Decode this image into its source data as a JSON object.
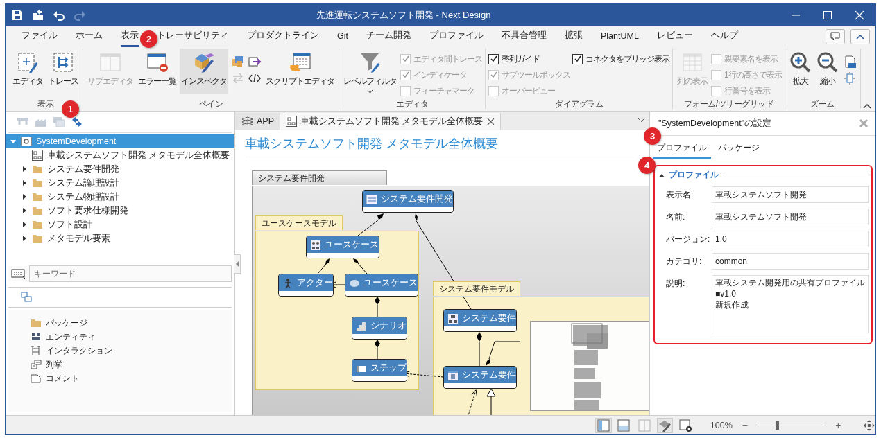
{
  "window": {
    "title": "先進運転システムソフト開発 - Next Design"
  },
  "menu_tabs": [
    {
      "label": "ファイル",
      "selected": false
    },
    {
      "label": "ホーム",
      "selected": false
    },
    {
      "label": "表示",
      "selected": true
    },
    {
      "label": "トレーサビリティ",
      "selected": false
    },
    {
      "label": "プロダクトライン",
      "selected": false
    },
    {
      "label": "Git",
      "selected": false
    },
    {
      "label": "チーム開発",
      "selected": false
    },
    {
      "label": "プロファイル",
      "selected": false
    },
    {
      "label": "不具合管理",
      "selected": false
    },
    {
      "label": "拡張",
      "selected": false
    },
    {
      "label": "PlantUML",
      "selected": false
    },
    {
      "label": "レビュー",
      "selected": false
    },
    {
      "label": "ヘルプ",
      "selected": false
    }
  ],
  "ribbon": [
    {
      "label": "表示",
      "columns": [
        [
          {
            "kind": "large",
            "label": "エディタ",
            "disabled": false,
            "selected": false
          }
        ],
        [
          {
            "kind": "large",
            "label": "トレース",
            "disabled": false,
            "selected": false
          }
        ]
      ]
    },
    {
      "label": "ペイン",
      "columns": [
        [
          {
            "kind": "large",
            "label": "サブエディタ",
            "disabled": true,
            "selected": false
          }
        ],
        [
          {
            "kind": "large",
            "label": "エラー一覧",
            "disabled": false,
            "selected": false
          }
        ],
        [
          {
            "kind": "large",
            "label": "インスペクタ",
            "disabled": false,
            "selected": true
          }
        ],
        [
          {
            "kind": "icon",
            "disabled": false
          },
          {
            "kind": "icon",
            "disabled": false
          },
          {
            "kind": "icon",
            "disabled": true
          },
          {
            "kind": "icon",
            "disabled": false
          }
        ],
        [
          {
            "kind": "large",
            "label": "スクリプトエディタ",
            "disabled": false,
            "selected": false
          }
        ]
      ]
    },
    {
      "label": "エディタ",
      "columns": [
        [
          {
            "kind": "large",
            "label": "レベルフィルタ",
            "disabled": false,
            "selected": false,
            "dropdown": true
          }
        ],
        [
          {
            "kind": "check",
            "label": "エディタ間トレース",
            "checked": true,
            "disabled": true
          },
          {
            "kind": "check",
            "label": "インディケータ",
            "checked": true,
            "disabled": true
          },
          {
            "kind": "check",
            "label": "フィーチャマーク",
            "checked": false,
            "disabled": true
          }
        ]
      ]
    },
    {
      "label": "ダイアグラム",
      "columns": [
        [
          {
            "kind": "check",
            "label": "整列ガイド",
            "checked": true,
            "disabled": false
          },
          {
            "kind": "check",
            "label": "サブツールボックス",
            "checked": true,
            "disabled": true
          },
          {
            "kind": "check",
            "label": "オーバービュー",
            "checked": false,
            "disabled": true
          }
        ],
        [
          {
            "kind": "check",
            "label": "コネクタをブリッジ表示",
            "checked": true,
            "disabled": false
          }
        ]
      ]
    },
    {
      "label": "フォーム/ツリーグリッド",
      "columns": [
        [
          {
            "kind": "large",
            "label": "列の表示",
            "disabled": true,
            "selected": false
          }
        ],
        [
          {
            "kind": "check",
            "label": "親要素名を表示",
            "checked": false,
            "disabled": true
          },
          {
            "kind": "check",
            "label": "1行の高さで表示",
            "checked": false,
            "disabled": true
          },
          {
            "kind": "check",
            "label": "行番号を表示",
            "checked": false,
            "disabled": true
          }
        ]
      ]
    },
    {
      "label": "ズーム",
      "columns": [
        [
          {
            "kind": "large",
            "label": "拡大",
            "disabled": false,
            "selected": false
          }
        ],
        [
          {
            "kind": "large",
            "label": "縮小",
            "disabled": false,
            "selected": false
          }
        ],
        [
          {
            "kind": "icon",
            "disabled": false
          },
          {
            "kind": "icon",
            "disabled": false
          }
        ]
      ]
    }
  ],
  "tree": [
    {
      "label": "SystemDevelopment",
      "kind": "model",
      "selected": true,
      "expanded": true,
      "children": [
        {
          "label": "車載システムソフト開発 メタモデル全体概要",
          "kind": "diagram",
          "selected": false
        },
        {
          "label": "システム要件開発",
          "kind": "folder",
          "selected": false,
          "expanded": false
        },
        {
          "label": "システム論理設計",
          "kind": "folder",
          "selected": false,
          "expanded": false
        },
        {
          "label": "システム物理設計",
          "kind": "folder",
          "selected": false,
          "expanded": false
        },
        {
          "label": "ソフト要求仕様開発",
          "kind": "folder",
          "selected": false,
          "expanded": false
        },
        {
          "label": "ソフト設計",
          "kind": "folder",
          "selected": false,
          "expanded": false
        },
        {
          "label": "メタモデル要素",
          "kind": "folder",
          "selected": false,
          "expanded": false
        }
      ]
    }
  ],
  "search": {
    "placeholder": "キーワード"
  },
  "palette": [
    {
      "label": "パッケージ"
    },
    {
      "label": "エンティティ"
    },
    {
      "label": "インタラクション"
    },
    {
      "label": "列挙"
    },
    {
      "label": "コメント"
    }
  ],
  "doc_tabs": [
    {
      "label": "APP",
      "selected": false,
      "closable": false
    },
    {
      "label": "車載システムソフト開発 メタモデル全体概要",
      "selected": true,
      "closable": true
    }
  ],
  "diagram": {
    "title": "車載システムソフト開発 メタモデル全体概要",
    "packages": [
      {
        "label": "システム要件開発"
      },
      {
        "label": "ユースケースモデル"
      },
      {
        "label": "システム要件モデル"
      }
    ],
    "nodes": [
      {
        "label": "システム要件開発"
      },
      {
        "label": "ユースケース"
      },
      {
        "label": "アクター"
      },
      {
        "label": "ユースケース"
      },
      {
        "label": "シナリオ"
      },
      {
        "label": "ステップ"
      },
      {
        "label": "システム要件"
      },
      {
        "label": "システム要件"
      }
    ]
  },
  "inspector": {
    "title": "\"SystemDevelopment\"の設定",
    "tabs": [
      {
        "label": "プロファイル",
        "selected": true
      },
      {
        "label": "パッケージ",
        "selected": false
      }
    ],
    "section": {
      "label": "プロファイル",
      "expanded": true,
      "highlighted": true,
      "fields": [
        {
          "label": "表示名:",
          "value": "車載システムソフト開発",
          "kind": "single"
        },
        {
          "label": "名前:",
          "value": "車載システムソフト開発",
          "kind": "single"
        },
        {
          "label": "バージョン:",
          "value": "1.0",
          "kind": "single"
        },
        {
          "label": "カテゴリ:",
          "value": "common",
          "kind": "single"
        },
        {
          "label": "説明:",
          "value": "車載システム開発用の共有プロファイル\n■v1.0\n新規作成",
          "kind": "multiline"
        }
      ]
    }
  },
  "status_bar": {
    "view_buttons": [
      {
        "selected": true,
        "disabled": false
      },
      {
        "selected": false,
        "disabled": false
      },
      {
        "selected": false,
        "disabled": true
      },
      {
        "selected": true,
        "disabled": false
      },
      {
        "selected": false,
        "disabled": false
      }
    ],
    "zoom": "100%",
    "zoom_out": "−",
    "zoom_in": "+",
    "zoom_slider": {
      "level": 0.26
    }
  },
  "callouts": [
    "1",
    "2",
    "3",
    "4"
  ]
}
